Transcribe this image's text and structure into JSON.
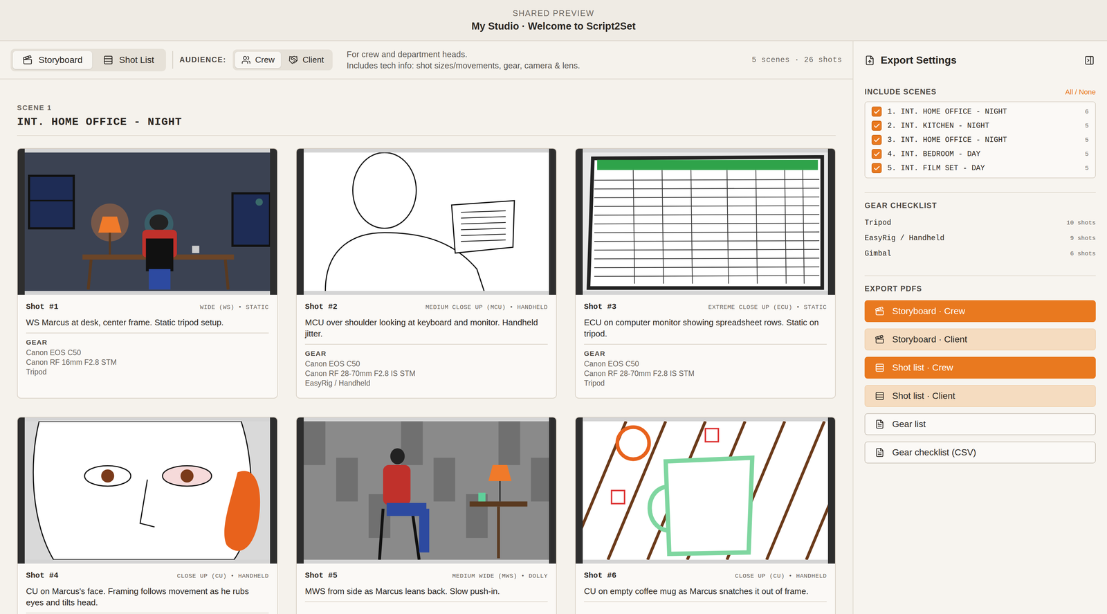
{
  "header": {
    "eyebrow": "SHARED PREVIEW",
    "title": "My Studio · Welcome to Script2Set"
  },
  "views": [
    {
      "label": "Storyboard",
      "kind": "storyboard",
      "selected": true
    },
    {
      "label": "Shot List",
      "kind": "shotlist",
      "selected": false
    }
  ],
  "audience": {
    "label": "AUDIENCE:",
    "options": [
      {
        "label": "Crew",
        "kind": "crew",
        "selected": true
      },
      {
        "label": "Client",
        "kind": "client",
        "selected": false
      }
    ]
  },
  "description": [
    "For crew and department heads.",
    "Includes tech info: shot sizes/movements, gear, camera & lens."
  ],
  "summary": "5 scenes · 26 shots",
  "scene": {
    "label": "SCENE 1",
    "title": "INT. HOME OFFICE - NIGHT",
    "gear_label": "GEAR",
    "shots": [
      {
        "number": "Shot #1",
        "type": "WIDE (WS) • STATIC",
        "description": "WS Marcus at desk, center frame. Static tripod setup.",
        "gear": [
          "Canon EOS C50",
          "Canon RF 16mm F2.8 STM",
          "Tripod"
        ]
      },
      {
        "number": "Shot #2",
        "type": "MEDIUM CLOSE UP (MCU) • HANDHELD",
        "description": "MCU over shoulder looking at keyboard and monitor. Handheld jitter.",
        "gear": [
          "Canon EOS C50",
          "Canon RF 28-70mm F2.8 IS STM",
          "EasyRig / Handheld"
        ]
      },
      {
        "number": "Shot #3",
        "type": "EXTREME CLOSE UP (ECU) • STATIC",
        "description": "ECU on computer monitor showing spreadsheet rows. Static on tripod.",
        "gear": [
          "Canon EOS C50",
          "Canon RF 28-70mm F2.8 IS STM",
          "Tripod"
        ]
      },
      {
        "number": "Shot #4",
        "type": "CLOSE UP (CU) • HANDHELD",
        "description": "CU on Marcus's face. Framing follows movement as he rubs eyes and tilts head.",
        "gear": []
      },
      {
        "number": "Shot #5",
        "type": "MEDIUM WIDE (MWS) • DOLLY",
        "description": "MWS from side as Marcus leans back. Slow push-in.",
        "gear": []
      },
      {
        "number": "Shot #6",
        "type": "CLOSE UP (CU) • HANDHELD",
        "description": "CU on empty coffee mug as Marcus snatches it out of frame.",
        "gear": []
      }
    ]
  },
  "export": {
    "title": "Export Settings",
    "include_label": "INCLUDE SCENES",
    "all": "All",
    "separator": "/",
    "none": "None",
    "scenes": [
      {
        "label": "1. INT. HOME OFFICE - NIGHT",
        "count": "6",
        "checked": true
      },
      {
        "label": "2. INT. KITCHEN - NIGHT",
        "count": "5",
        "checked": true
      },
      {
        "label": "3. INT. HOME OFFICE - NIGHT",
        "count": "5",
        "checked": true
      },
      {
        "label": "4. INT. BEDROOM - DAY",
        "count": "5",
        "checked": true
      },
      {
        "label": "5. INT. FILM SET - DAY",
        "count": "5",
        "checked": true
      }
    ],
    "gear_label": "GEAR CHECKLIST",
    "gear": [
      {
        "name": "Tripod",
        "count": "10 shots"
      },
      {
        "name": "EasyRig / Handheld",
        "count": "9 shots"
      },
      {
        "name": "Gimbal",
        "count": "6 shots"
      }
    ],
    "pdf_label": "EXPORT PDFS",
    "pdfs": [
      {
        "label": "Storyboard · Crew",
        "kind": "storyboard",
        "variant": "primary"
      },
      {
        "label": "Storyboard · Client",
        "kind": "storyboard",
        "variant": "secondary"
      },
      {
        "label": "Shot list · Crew",
        "kind": "shotlist",
        "variant": "primary"
      },
      {
        "label": "Shot list · Client",
        "kind": "shotlist",
        "variant": "secondary"
      },
      {
        "label": "Gear list",
        "kind": "file",
        "variant": "outline"
      },
      {
        "label": "Gear checklist (CSV)",
        "kind": "file",
        "variant": "outline"
      }
    ]
  }
}
